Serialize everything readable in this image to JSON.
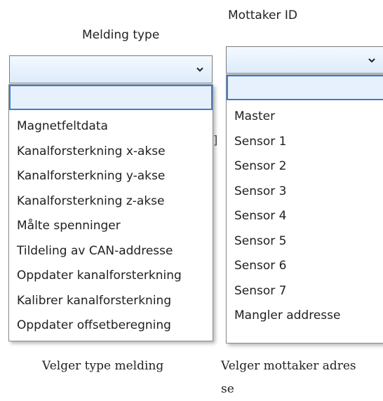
{
  "left": {
    "label": "Melding type",
    "selected_value": "",
    "options": [
      "Magnetfeltdata",
      "Kanalforsterkning x-akse",
      "Kanalforsterkning y-akse",
      "Kanalforsterkning z-akse",
      "Målte spenninger",
      "Tildeling av CAN-addresse",
      "Oppdater kanalforsterkning",
      "Kalibrer kanalforsterkning",
      "Oppdater offsetberegning"
    ],
    "caption": "Velger type melding"
  },
  "right": {
    "label": "Mottaker ID",
    "selected_value": "",
    "options": [
      "Master",
      "Sensor 1",
      "Sensor 2",
      "Sensor 3",
      "Sensor 4",
      "Sensor 5",
      "Sensor 6",
      "Sensor 7",
      "Mangler addresse"
    ],
    "caption_line1": "Velger mottaker adres",
    "caption_line2": "se"
  },
  "background_glyph": "]",
  "colors": {
    "highlight_border": "#3b7fd1",
    "highlight_fill": "#e7f1fd",
    "combo_fill_top": "#f4f9ff",
    "combo_fill_bottom": "#dcebfb"
  },
  "icons": {
    "dropdown_arrow": "chevron-down-icon"
  }
}
